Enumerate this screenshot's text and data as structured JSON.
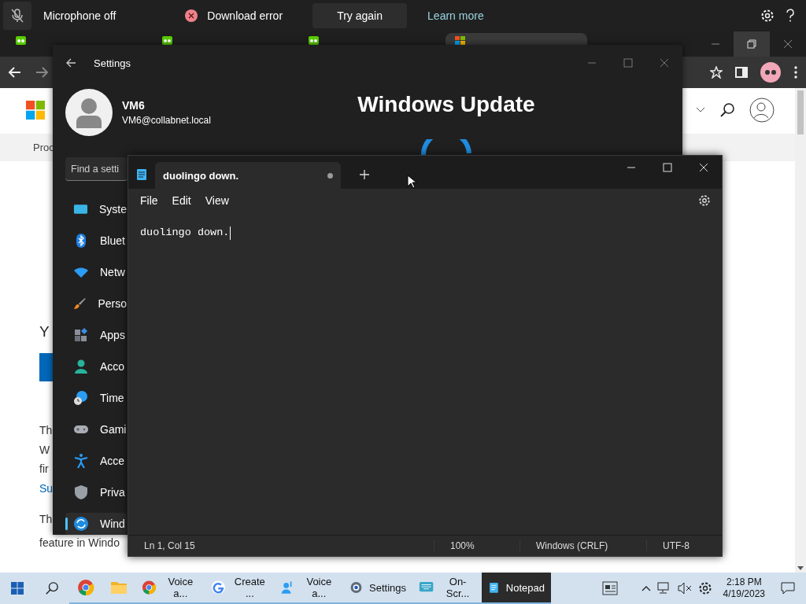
{
  "notification_bar": {
    "mic_label": "Microphone off",
    "error_label": "Download error",
    "try_again": "Try again",
    "learn_more": "Learn more"
  },
  "browser": {
    "tabs": [
      {
        "kind": "owl",
        "selected": false
      },
      {
        "kind": "owl",
        "selected": false
      },
      {
        "kind": "owl",
        "selected": false
      },
      {
        "kind": "windows",
        "selected": true
      }
    ],
    "page": {
      "nav_text": "Proc",
      "subheading": "Y",
      "paragraph_lines": [
        "Th",
        "W",
        "fir"
      ],
      "link": "Su",
      "paragraph2_lines": [
        "Th",
        "feature in Windo"
      ]
    }
  },
  "settings": {
    "title": "Settings",
    "user_name": "VM6",
    "user_email": "VM6@collabnet.local",
    "page_title": "Windows Update",
    "search_placeholder": "Find a setti",
    "nav": [
      {
        "kind": "system",
        "label": "Syste",
        "selected": false
      },
      {
        "kind": "bluetooth",
        "label": "Bluet",
        "selected": false
      },
      {
        "kind": "network",
        "label": "Netw",
        "selected": false
      },
      {
        "kind": "brush",
        "label": "Perso",
        "selected": false
      },
      {
        "kind": "apps",
        "label": "Apps",
        "selected": false
      },
      {
        "kind": "account",
        "label": "Acco",
        "selected": false
      },
      {
        "kind": "time",
        "label": "Time",
        "selected": false
      },
      {
        "kind": "gaming",
        "label": "Gami",
        "selected": false
      },
      {
        "kind": "accessibility",
        "label": "Acce",
        "selected": false
      },
      {
        "kind": "privacy",
        "label": "Priva",
        "selected": false
      },
      {
        "kind": "update",
        "label": "Wind",
        "selected": true
      }
    ]
  },
  "notepad": {
    "tab_title": "duolingo down.",
    "unsaved": true,
    "menu": [
      "File",
      "Edit",
      "View"
    ],
    "content": "duolingo down.",
    "status": [
      "Ln 1, Col 15",
      "100%",
      "Windows (CRLF)",
      "UTF-8"
    ]
  },
  "taskbar": {
    "apps": [
      {
        "kind": "chrome",
        "selected": false
      },
      {
        "kind": "folder",
        "selected": false
      },
      {
        "kind": "chrome",
        "label": "Voice a...",
        "selected": false
      },
      {
        "kind": "google",
        "label": "Create ...",
        "selected": false
      },
      {
        "kind": "person",
        "label": "Voice a...",
        "selected": false
      },
      {
        "kind": "settings",
        "label": "Settings",
        "selected": false
      },
      {
        "kind": "keyboard",
        "label": "On-Scr...",
        "selected": false
      },
      {
        "kind": "notepad",
        "label": "Notepad",
        "selected": true
      }
    ],
    "time": "2:18 PM",
    "date": "4/19/2023"
  }
}
